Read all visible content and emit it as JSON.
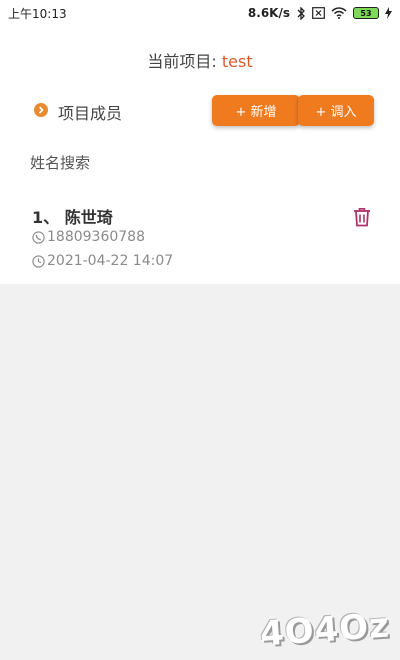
{
  "status_bar": {
    "time": "上午10:13",
    "network_speed": "8.6K/s",
    "battery": "53",
    "icons": [
      "bluetooth-icon",
      "sim-x-icon",
      "wifi-icon",
      "battery-icon",
      "charging-icon"
    ]
  },
  "project": {
    "label": "当前项目:",
    "name": "test"
  },
  "members": {
    "section_title": "项目成员",
    "add_label": "+ 新增",
    "import_label": "+ 调入"
  },
  "search": {
    "placeholder": "姓名搜索"
  },
  "member_list": [
    {
      "name": "1、 陈世琦",
      "phone": "18809360788",
      "datetime": "2021-04-22 14:07"
    }
  ],
  "watermark": "4O4Oz",
  "colors": {
    "accent": "#f07a1e",
    "project_name": "#d65a2c",
    "delete_icon": "#b0306a",
    "background": "#f1f1f1"
  }
}
